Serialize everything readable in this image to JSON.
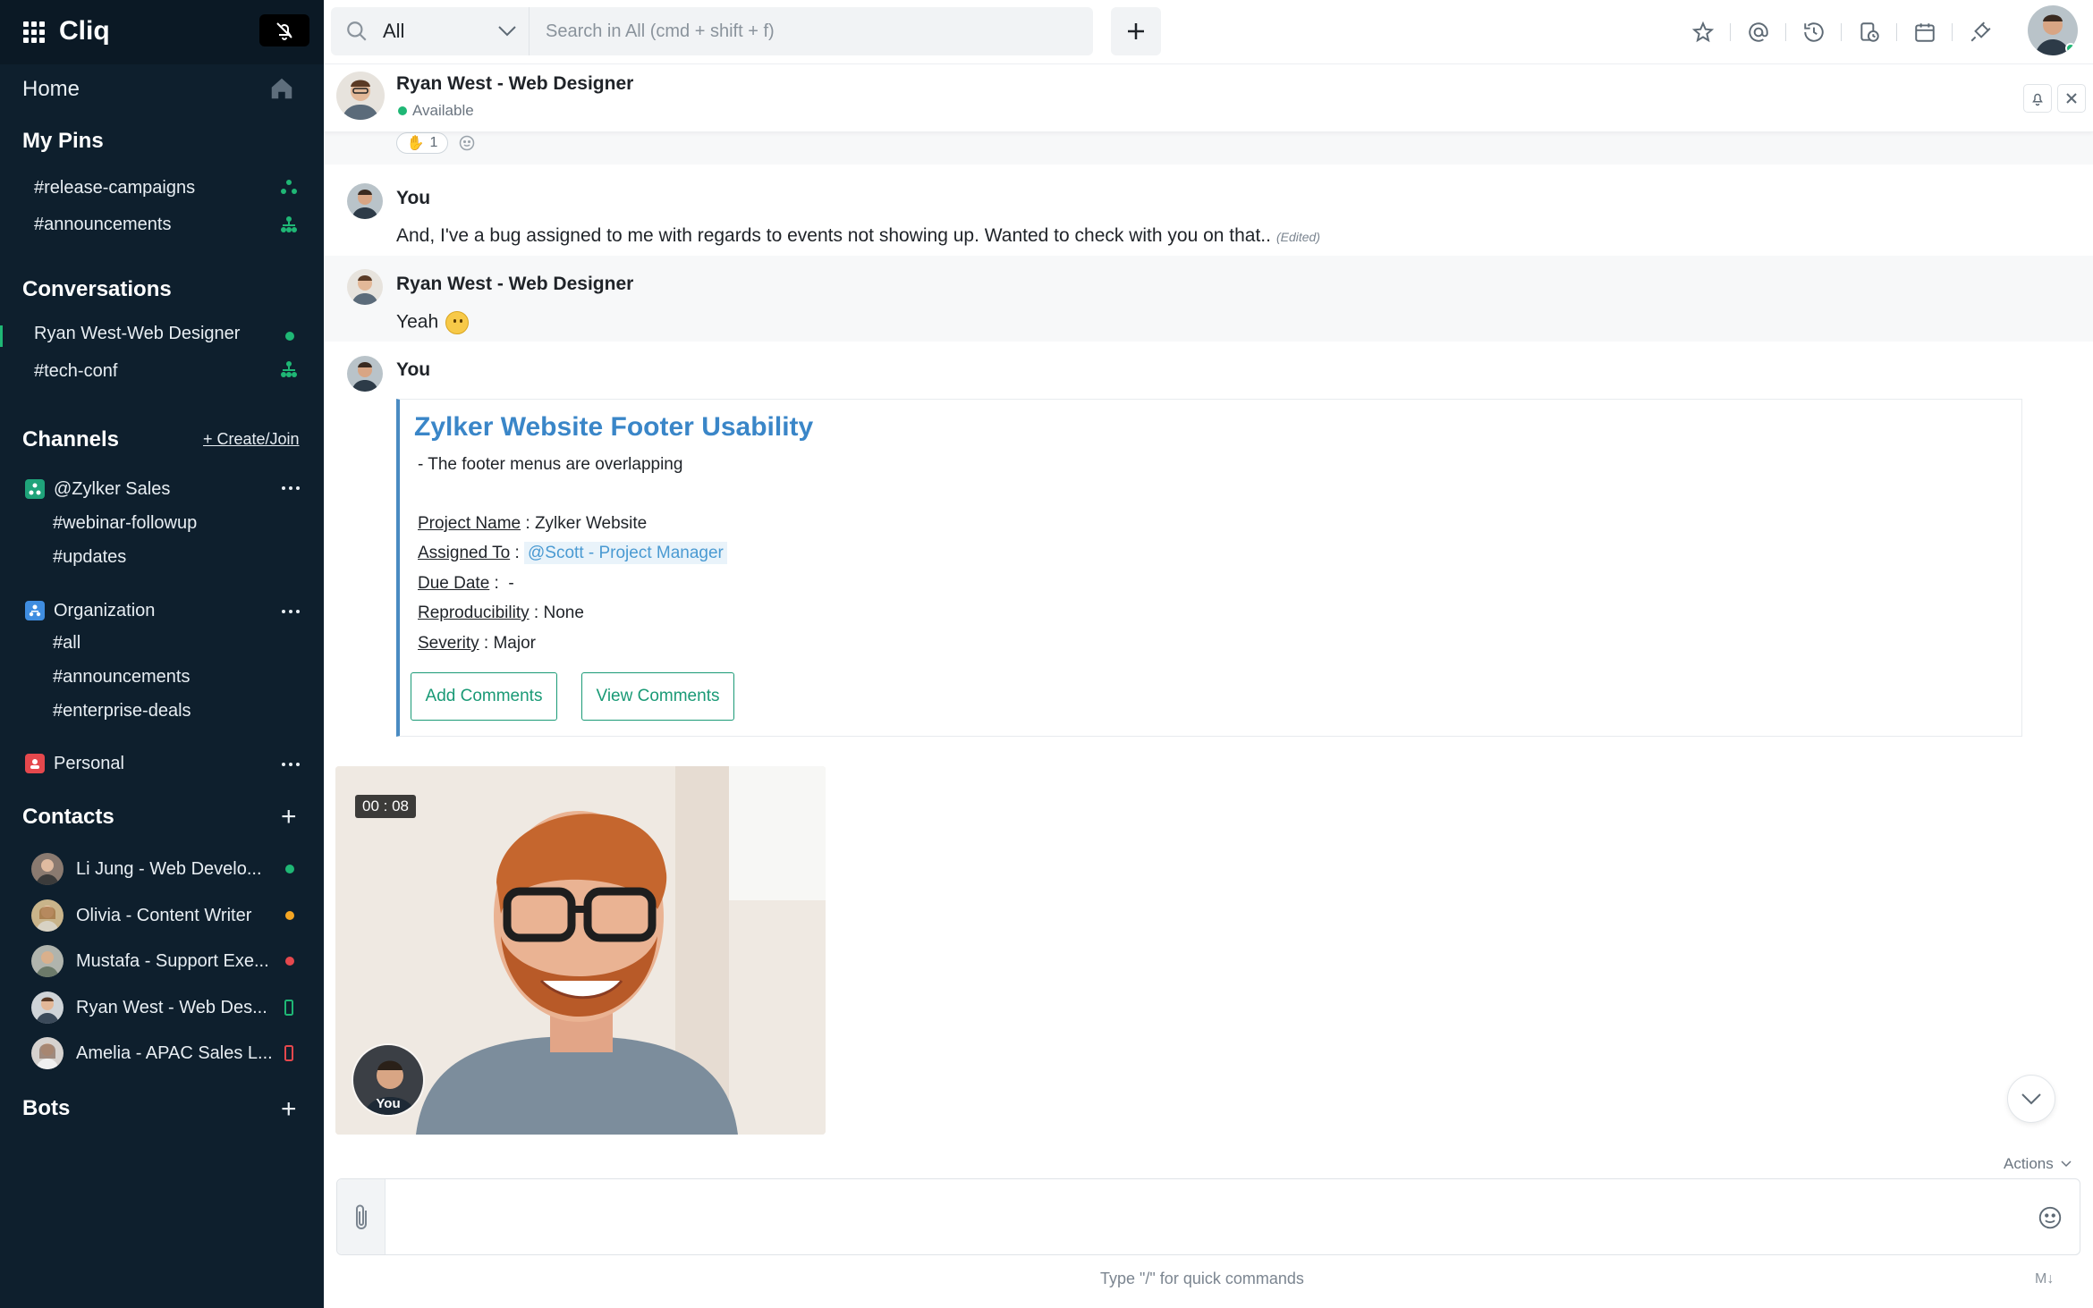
{
  "app": {
    "name": "Cliq"
  },
  "colors": {
    "accent": "#1fb775",
    "link": "#3a86c8",
    "sidebar_bg": "#0e1f2d",
    "button_green": "#1a9a76"
  },
  "sidebar": {
    "home": "Home",
    "pins_title": "My Pins",
    "pins": [
      {
        "label": "#release-campaigns"
      },
      {
        "label": "#announcements"
      }
    ],
    "conversations_title": "Conversations",
    "conversations": [
      {
        "label": "Ryan West-Web Designer",
        "status": "online"
      },
      {
        "label": "#tech-conf"
      }
    ],
    "channels_title": "Channels",
    "create_join": "+ Create/Join",
    "groups": [
      {
        "label": "@Zylker Sales",
        "channels": [
          "#webinar-followup",
          "#updates"
        ]
      },
      {
        "label": "Organization",
        "channels": [
          "#all",
          "#announcements",
          "#enterprise-deals"
        ]
      },
      {
        "label": "Personal",
        "channels": []
      }
    ],
    "contacts_title": "Contacts",
    "contacts": [
      {
        "name": "Li Jung  - Web Develo...",
        "status": "online"
      },
      {
        "name": "Olivia - Content Writer",
        "status": "away"
      },
      {
        "name": "Mustafa - Support Exe...",
        "status": "busy"
      },
      {
        "name": "Ryan West - Web Des...",
        "status": "mobile"
      },
      {
        "name": "Amelia - APAC Sales L...",
        "status": "mobile-busy"
      }
    ],
    "bots_title": "Bots"
  },
  "search": {
    "scope": "All",
    "placeholder": "Search in All (cmd + shift + f)"
  },
  "chat": {
    "name": "Ryan West - Web Designer",
    "status": "Available",
    "reaction_count": "1"
  },
  "messages": [
    {
      "sender": "You",
      "text": "And, I've a bug assigned to me with regards to events not showing up. Wanted to check with you on that..",
      "edited": "(Edited)"
    },
    {
      "sender": "Ryan West - Web Designer",
      "text": "Yeah"
    },
    {
      "sender": "You"
    }
  ],
  "card": {
    "title": "Zylker Website Footer Usability",
    "description": "- The footer menus are overlapping",
    "fields": [
      {
        "key": "Project Name",
        "value": "Zylker Website"
      },
      {
        "key": "Assigned To",
        "value": "@Scott - Project Manager"
      },
      {
        "key": "Due Date",
        "value": "-"
      },
      {
        "key": "Reproducibility",
        "value": "None"
      },
      {
        "key": "Severity",
        "value": "Major"
      }
    ],
    "buttons": {
      "add": "Add Comments",
      "view": "View Comments"
    }
  },
  "video": {
    "timer": "00 : 08",
    "self_label": "You"
  },
  "composer": {
    "actions": "Actions",
    "hint": "Type \"/\" for quick commands",
    "markdown": "M"
  }
}
